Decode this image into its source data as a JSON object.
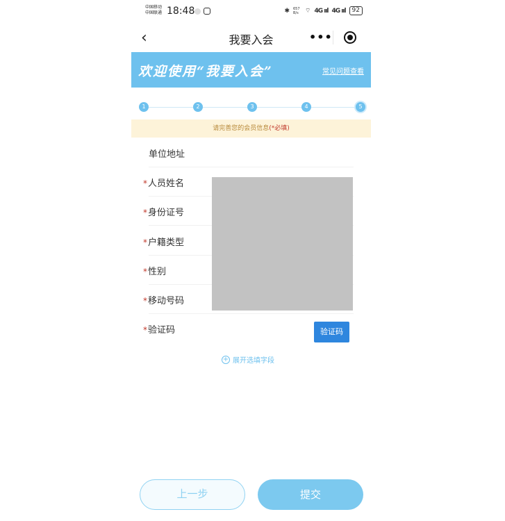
{
  "status_bar": {
    "carrier_1": "中国移动",
    "carrier_2": "中国联通",
    "time": "18:48",
    "net_speed": "657 B/s",
    "signal_1": "4G ııl",
    "signal_2": "4G ııl",
    "battery": "92"
  },
  "nav": {
    "back_icon": "‹",
    "title": "我要入会",
    "more_icon": "•••"
  },
  "banner": {
    "title": "欢迎使用“我要入会”",
    "faq_link": "常见问题查看"
  },
  "steps": {
    "items": [
      "1",
      "2",
      "3",
      "4",
      "5"
    ],
    "active": 5
  },
  "notice": {
    "text": "请完善您的会员信息",
    "required": "(*必填)"
  },
  "form": {
    "fields": [
      {
        "label": "单位地址",
        "required": false
      },
      {
        "label": "人员姓名",
        "required": true
      },
      {
        "label": "身份证号",
        "required": true
      },
      {
        "label": "户籍类型",
        "required": true
      },
      {
        "label": "性别",
        "required": true
      },
      {
        "label": "移动号码",
        "required": true
      },
      {
        "label": "验证码",
        "required": true
      }
    ],
    "required_mark": "*",
    "verify_button": "验证码",
    "expand_icon": "+",
    "expand_label": "展开选填字段"
  },
  "buttons": {
    "prev": "上一步",
    "submit": "提交"
  },
  "colors": {
    "primary": "#6ec1ee",
    "verify_button": "#2e86de",
    "notice_bg": "#fdf3d9",
    "required": "#c0392b"
  }
}
